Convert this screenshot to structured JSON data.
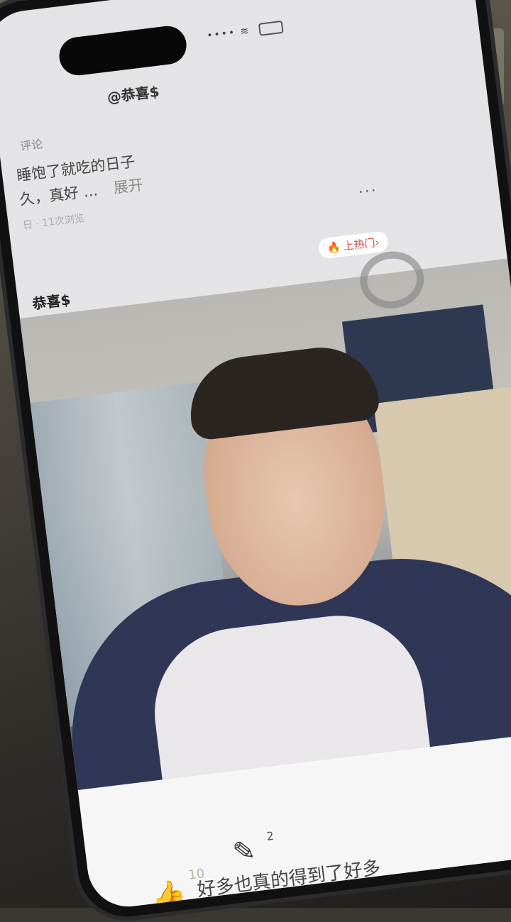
{
  "header": {
    "title": "@恭喜$"
  },
  "post": {
    "meta": "评论",
    "line1": "睡饱了就吃的日子",
    "line2": "久，真好 ...",
    "expand_label": "展开",
    "views_prefix": "日",
    "views": "11次浏览",
    "more_icon": "more-dots-icon"
  },
  "card": {
    "username": "恭喜$",
    "hot_tag": "上热门",
    "hot_tag_chevron": "›",
    "hot_icon": "fire-icon"
  },
  "footer": {
    "like_icon": "thumbs-up-icon",
    "like_count": "10",
    "comment_icon": "pencil-icon",
    "comment_count": "2",
    "caption": "好多也真的得到了好多"
  },
  "colors": {
    "accent_red": "#e0464b",
    "thumb_yellow": "#e8a12a"
  }
}
